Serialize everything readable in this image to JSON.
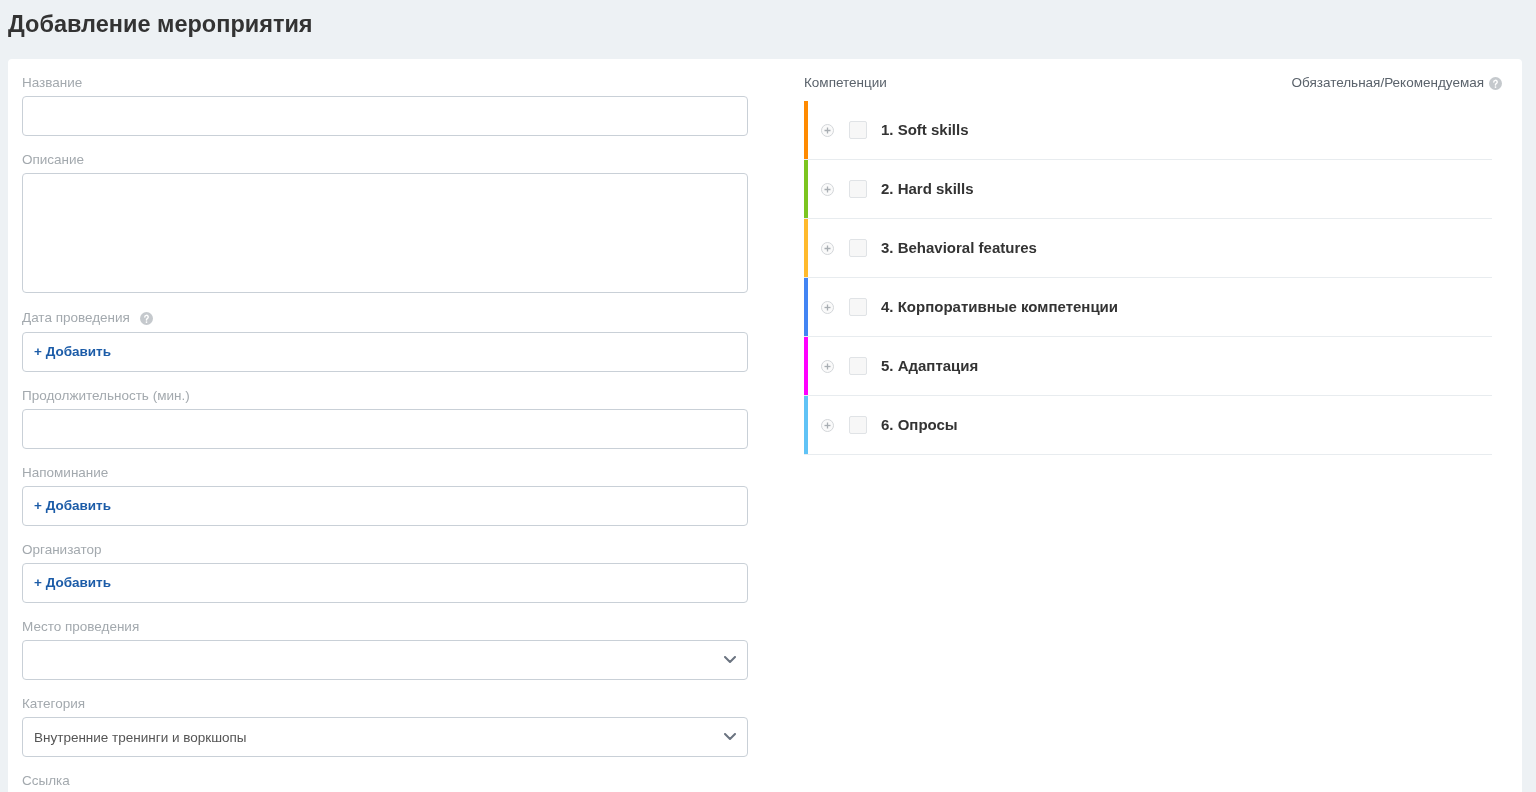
{
  "page": {
    "title": "Добавление мероприятия"
  },
  "form": {
    "fields": [
      {
        "label": "Название",
        "kind": "input",
        "help": false
      },
      {
        "label": "Описание",
        "kind": "textarea",
        "help": false
      },
      {
        "label": "Дата проведения",
        "kind": "add",
        "help": true,
        "action": "+ Добавить"
      },
      {
        "label": "Продолжительность (мин.)",
        "kind": "input",
        "help": false
      },
      {
        "label": "Напоминание",
        "kind": "add",
        "help": false,
        "action": "+ Добавить"
      },
      {
        "label": "Организатор",
        "kind": "add",
        "help": false,
        "action": "+ Добавить"
      },
      {
        "label": "Место проведения",
        "kind": "select",
        "help": false
      },
      {
        "label": "Категория",
        "kind": "select",
        "help": false,
        "value": "Внутренние тренинги и воркшопы"
      },
      {
        "label": "Ссылка",
        "kind": "label",
        "help": false
      }
    ]
  },
  "competencies": {
    "label": "Компетенции",
    "column_label": "Обязательная/Рекомендуемая",
    "items": [
      {
        "label": "1. Soft skills",
        "color": "#ff8a00",
        "expanded": false,
        "checked": false
      },
      {
        "label": "2. Hard skills",
        "color": "#7cc520",
        "expanded": false,
        "checked": false
      },
      {
        "label": "3. Behavioral features",
        "color": "#ffba2d",
        "expanded": false,
        "checked": false
      },
      {
        "label": "4. Корпоративные компетенции",
        "color": "#4285f4",
        "expanded": false,
        "checked": false
      },
      {
        "label": "5. Адаптация",
        "color": "#ff00ff",
        "expanded": false,
        "checked": false
      },
      {
        "label": "6. Опросы",
        "color": "#60c3f6",
        "expanded": false,
        "checked": false
      }
    ]
  }
}
